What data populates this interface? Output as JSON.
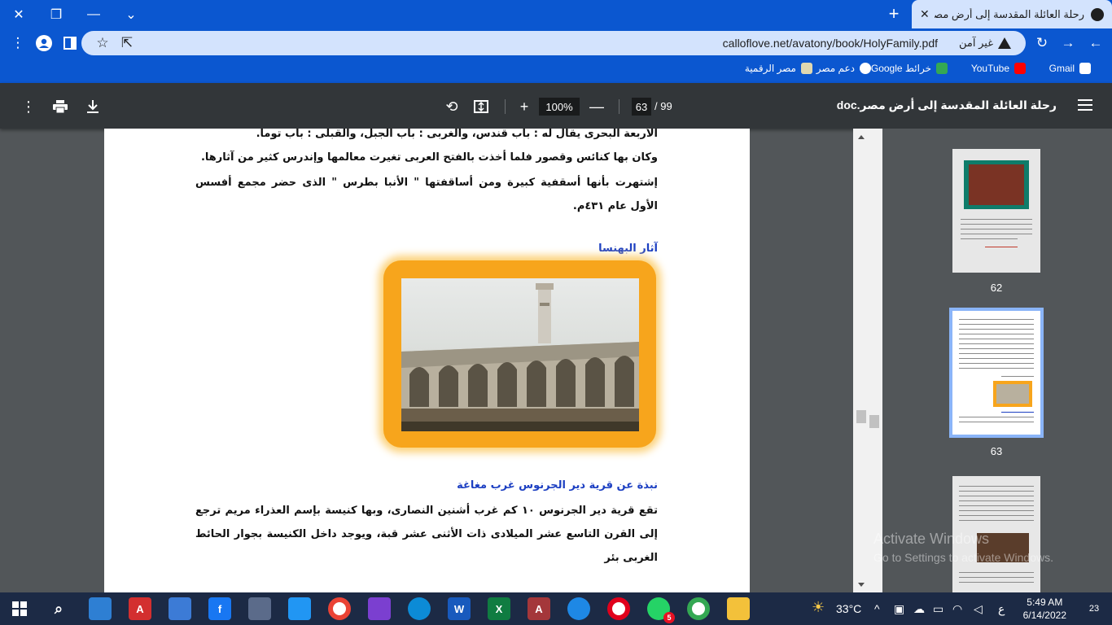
{
  "browser": {
    "tab_title": "رحلة العائلة المقدسة إلى أرض مصر",
    "url": "calloflove.net/avatony/book/HolyFamily.pdf",
    "security_label": "غير آمن",
    "window_minimize": "—",
    "window_restore": "❐",
    "window_close": "✕",
    "tab_search": "⌄",
    "new_tab": "+",
    "tab_close": "✕"
  },
  "bookmarks": [
    {
      "label": "Gmail",
      "color": "#ea4335"
    },
    {
      "label": "YouTube",
      "color": "#ff0000"
    },
    {
      "label": "خرائط Google",
      "color": "#34a853"
    },
    {
      "label": "دعم مصر",
      "color": "#ffffff"
    },
    {
      "label": "مصر الرقمية",
      "color": "#e0d8b0"
    }
  ],
  "pdf": {
    "title": "رحلة العائلة المقدسة إلى أرض مصر.doc",
    "current_page": "63",
    "total_pages": "/ 99",
    "zoom": "100%",
    "content": {
      "line_top": "الأربعة البحرى يقال له : باب قندس، والغربى : باب الجبل، والقبلى : باب توما.",
      "para_1": "وكان بها كنائس وقصور فلما أخذت بالفتح العربى تغيرت معالمها وإندرس كثير من آثارها.",
      "para_2": "إشتهرت بأنها أسقفية كبيرة ومن أساقفتها \" الأنبا بطرس \" الذى حضر مجمع أفسس الأول عام ٤٣١م.",
      "heading_1": "آثار البهنسا",
      "heading_2": "نبذة عن قرية دير الجرنوس غرب مغاغة",
      "para_3": "تقع قرية دير الجرنوس ١٠ كم غرب أشنين النصارى، وبها كنيسة بإسم العذراء مريم ترجع إلى القرن التاسع عشر الميلادى ذات الأثنى عشر قبة، ويوجد داخل الكنيسة بجوار الحائط الغربى بئر"
    },
    "thumbnails": [
      {
        "page": "62"
      },
      {
        "page": "63"
      },
      {
        "page": ""
      }
    ]
  },
  "watermark": {
    "line1": "Activate Windows",
    "line2": "Go to Settings to activate Windows."
  },
  "taskbar": {
    "weather": "33°C",
    "time": "5:49 AM",
    "date": "6/14/2022",
    "lang": "ع",
    "notifications": "23",
    "whatsapp_badge": "5"
  }
}
